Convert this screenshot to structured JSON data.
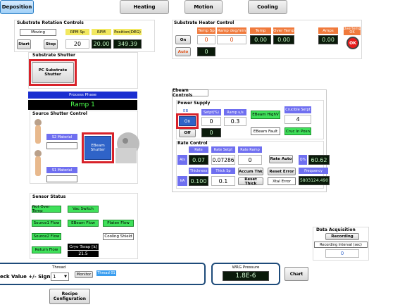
{
  "tabs": [
    "Deposition",
    "Heating",
    "Motion",
    "Cooling"
  ],
  "rotation": {
    "title": "Substrate Rotation Controls",
    "status": "Moving",
    "start": "Start",
    "stop": "Stop",
    "headers": [
      "RPM Sp",
      "RPM",
      "Position(DEG)"
    ],
    "rpm_sp": "20",
    "rpm": "20.00",
    "position": "349.39"
  },
  "shutter": {
    "title": "Substrate Shutter",
    "button": "PC Substrate Shutter"
  },
  "process": {
    "label": "Process Phase",
    "phase": "Ramp 1"
  },
  "source_shutter": {
    "title": "Source Shutter Control",
    "mat2": "S2 Material",
    "mat1": "S1 Material",
    "ebeam": "EBeam Shutter"
  },
  "sensors": {
    "title": "Sensor Status",
    "items": [
      "Not Over Temp",
      "Vac Switch",
      "Source1 Flow",
      "EBeam Flow",
      "Platen Flow",
      "Source2 Flow",
      "Cooling Shield",
      "Return Flow"
    ],
    "cryo_label": "Cryo Temp [k]",
    "cryo_value": "21.5"
  },
  "heater": {
    "title": "Substrate Heater Control",
    "on": "On",
    "auto": "Auto",
    "headers": [
      "Temp Sp",
      "Ramp deg/min",
      "Temp",
      "Over Temp",
      "Amps",
      "Overtemp OK"
    ],
    "temp_sp": "0",
    "ramp": "0",
    "temp": "0.00",
    "over_temp": "0.00",
    "amps": "0.00",
    "ok": "OK",
    "auto_value": "0"
  },
  "ebeam": {
    "title": "Ebeam Controls",
    "power_title": "Power Supply",
    "eb_label": "EB",
    "on": "On",
    "off": "Off",
    "setpt_label": "Setpt(%)",
    "setpt": "0",
    "ramp_label": "Ramp u/s",
    "ramp": "0.3",
    "off_value": "0",
    "high_v": "EBeam HighV",
    "fault": "EBeam Fault",
    "crucible_label": "Crucible Setpt",
    "crucible": "4",
    "cruc_pos": "Cruc In Posn",
    "rate_title": "Rate Control",
    "as_label": "A/s",
    "ka_label": "kA",
    "rate_label": "Rate",
    "rate": "0.07",
    "rate_setpt_label": "Rate Setpt",
    "rate_setpt": "0.07286",
    "rate_ramp_label": "Rate Ramp",
    "rate_ramp": "0",
    "rate_auto": "Rate Auto",
    "q_label": "Q%",
    "q_value": "60.62",
    "thickness_label": "Thickness",
    "thickness": "0.100",
    "thick_sp_label": "Thick Sp",
    "thick_sp": "0.1",
    "accum": "Accum Thk",
    "reset_error": "Reset Error",
    "reset_thick": "Reset Thick",
    "xtal_error": "Xtal Error",
    "freq_label": "Frequency",
    "frequency": "5803124.490"
  },
  "acquisition": {
    "title": "Data Acquisition",
    "recording": "Recording",
    "interval_label": "Recording Interval (sec)",
    "interval": "0"
  },
  "bottom": {
    "thread_label": "Thread",
    "select_text": "eck Value +/- Signal",
    "thread_num": "1",
    "monitor": "Monitor",
    "thread_tag": "Thread 01",
    "wrg_label": "WRG Pressure",
    "wrg_value": "1.8E-6",
    "chart": "Chart",
    "recipe": "Recipe Configuration"
  }
}
